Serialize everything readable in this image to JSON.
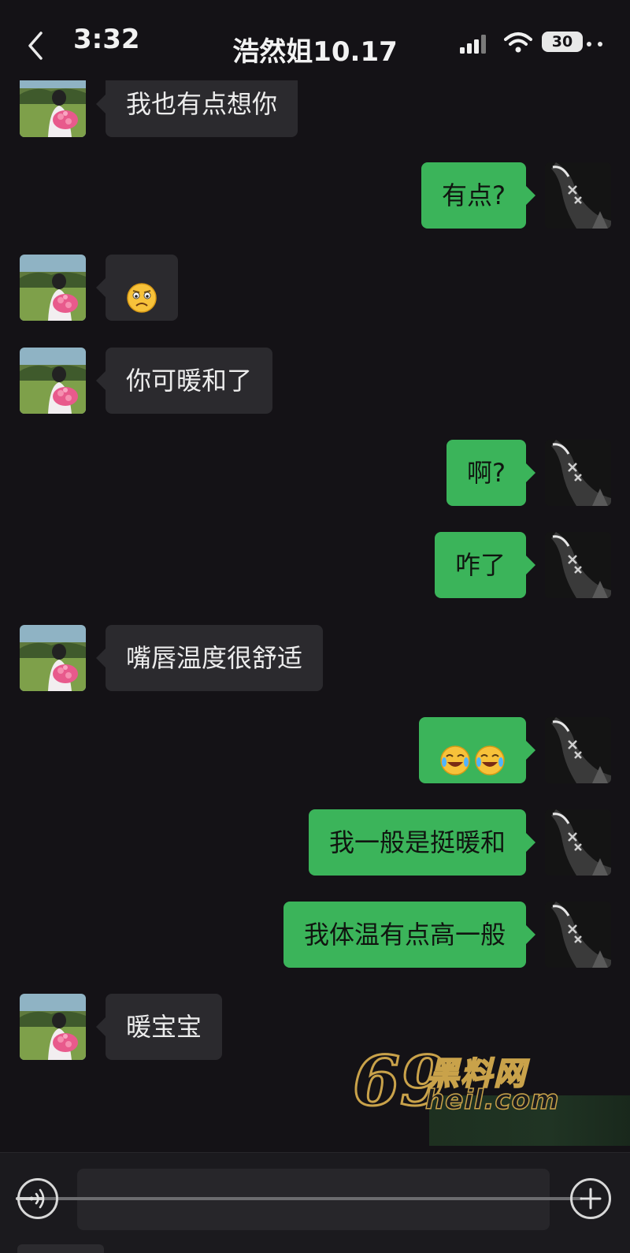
{
  "status_bar": {
    "time": "3:32",
    "battery": "30"
  },
  "header": {
    "title": "浩然姐10.17"
  },
  "messages": [
    {
      "side": "in",
      "text": "我也有点想你"
    },
    {
      "side": "out",
      "text": "有点?"
    },
    {
      "side": "in",
      "emoji": [
        "frowning-face-emoji"
      ]
    },
    {
      "side": "in",
      "text": "你可暖和了"
    },
    {
      "side": "out",
      "text": "啊?"
    },
    {
      "side": "out",
      "text": "咋了"
    },
    {
      "side": "in",
      "text": "嘴唇温度很舒适"
    },
    {
      "side": "out",
      "emoji": [
        "crying-laughing-emoji",
        "crying-laughing-emoji"
      ]
    },
    {
      "side": "out",
      "text": "我一般是挺暖和"
    },
    {
      "side": "out",
      "text": "我体温有点高一般"
    },
    {
      "side": "in",
      "text": "暖宝宝"
    }
  ],
  "watermark": {
    "number": "69",
    "name": "黑料网",
    "site": "heil.com"
  },
  "input_bar": {
    "placeholder": "",
    "progress": 0.05
  },
  "colors": {
    "background": "#141216",
    "incoming_bubble": "#2b2a2e",
    "outgoing_bubble": "#3bb45a",
    "watermark": "#c9a24a"
  }
}
